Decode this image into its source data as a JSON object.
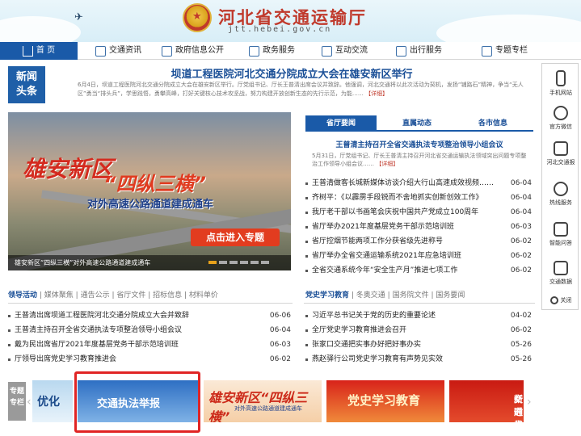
{
  "header": {
    "site_title": "河北省交通运输厅",
    "site_url": "jtt.hebei.gov.cn"
  },
  "nav": {
    "items": [
      {
        "label": "首 页",
        "icon": "home-icon"
      },
      {
        "label": "交通资讯",
        "icon": "news-icon"
      },
      {
        "label": "政府信息公开",
        "icon": "document-icon"
      },
      {
        "label": "政务服务",
        "icon": "edit-icon"
      },
      {
        "label": "互动交流",
        "icon": "chat-icon"
      },
      {
        "label": "出行服务",
        "icon": "car-icon"
      },
      {
        "label": "专题专栏",
        "icon": "folder-icon"
      }
    ]
  },
  "headline": {
    "badge": [
      "新闻",
      "头条"
    ],
    "title": "坝道工程医院河北交通分院成立大会在雄安新区举行",
    "summary": "6月4日，坝道工程医院河北交通分院成立大会在雄安新区举行。厅党组书记、厅长王普清出席会议并致辞。他强调，河北交通将以此次活动为契机，发扬“铺路石”精神，争当“无人区”勇当“排头兵”，学思践悟，勇攀高峰，打好关键核心技术攻坚战，努力构建开放创新生态的先行示范，为能……",
    "more": "【详细】"
  },
  "sidebar": {
    "items": [
      {
        "label": "手机网站",
        "icon": "phone-icon"
      },
      {
        "label": "官方微信",
        "icon": "wechat-icon"
      },
      {
        "label": "河北交通报",
        "icon": "newspaper-icon"
      },
      {
        "label": "热线服务",
        "icon": "headset-icon"
      },
      {
        "label": "智能问答",
        "icon": "robot-icon"
      },
      {
        "label": "交通数据",
        "icon": "data-icon"
      },
      {
        "label": "关闭",
        "icon": "close-icon"
      }
    ]
  },
  "banner": {
    "title_big": "雄安新区",
    "title_mid": "“四纵三横”",
    "subtitle": "对外高速公路通道建成通车",
    "button": "点击进入专题",
    "caption": "雄安新区“四纵三横”对外高速公路通道建成通车"
  },
  "news_tabs": {
    "tabs": [
      "省厅要闻",
      "直属动态",
      "各市信息"
    ],
    "feature_title": "王普清主持召开全省交通执法专项整治领导小组会议",
    "feature_summary": "5月31日，厅党组书记、厅长王普清主持召开河北省交通运输执法领域突出问题专项整治工作领导小组会议……",
    "feature_more": "【详细】",
    "items": [
      {
        "title": "王普清做客长城新媒体访谈介绍大行山高速成效视频……",
        "date": "06-04"
      },
      {
        "title": "齐树平：《以霹雳手段锐而不舍地抓实创新创效工作》",
        "date": "06-04"
      },
      {
        "title": "我厅老干部以书画笔会庆祝中国共产党成立100周年",
        "date": "06-04"
      },
      {
        "title": "省厅举办2021年度基层党务干部示范培训班",
        "date": "06-03"
      },
      {
        "title": "省厅控烟节能两项工作分获省级先进称号",
        "date": "06-02"
      },
      {
        "title": "省厅举办全省交通运输系统2021年应急培训班",
        "date": "06-02"
      },
      {
        "title": "全省交通系统今年“安全生产月”推进七项工作",
        "date": "06-02"
      }
    ]
  },
  "lower_left": {
    "tabs": [
      "领导活动",
      "媒体聚焦",
      "通告公示",
      "省厅文件",
      "招标信息",
      "材料单价"
    ],
    "items": [
      {
        "title": "王普清出席坝道工程医院河北交通分院成立大会并致辞",
        "date": "06-06"
      },
      {
        "title": "王普清主持召开全省交通执法专项整治领导小组会议",
        "date": "06-04"
      },
      {
        "title": "戴为民出席省厅2021年度基层党务干部示范培训班",
        "date": "06-03"
      },
      {
        "title": "厅领导出席党史学习教育推进会",
        "date": "06-02"
      }
    ]
  },
  "lower_right": {
    "tabs": [
      "党史学习教育",
      "冬奥交通",
      "国务院文件",
      "国务要闻"
    ],
    "items": [
      {
        "title": "习近平总书记关于党的历史的重要论述",
        "date": "04-02"
      },
      {
        "title": "全厅党史学习教育推进会召开",
        "date": "06-02"
      },
      {
        "title": "张家口交通把实事办好把好事办实",
        "date": "05-26"
      },
      {
        "title": "燕赵驿行公司党史学习教育有声势见实效",
        "date": "05-26"
      }
    ]
  },
  "topics": {
    "label": [
      "专题",
      "专栏"
    ],
    "items": [
      "优化",
      "交通执法举报",
      "雄安新区“四纵三横”",
      "对外高速公路通道建成通车",
      "党史学习教育",
      "新时代",
      "交通党"
    ]
  }
}
